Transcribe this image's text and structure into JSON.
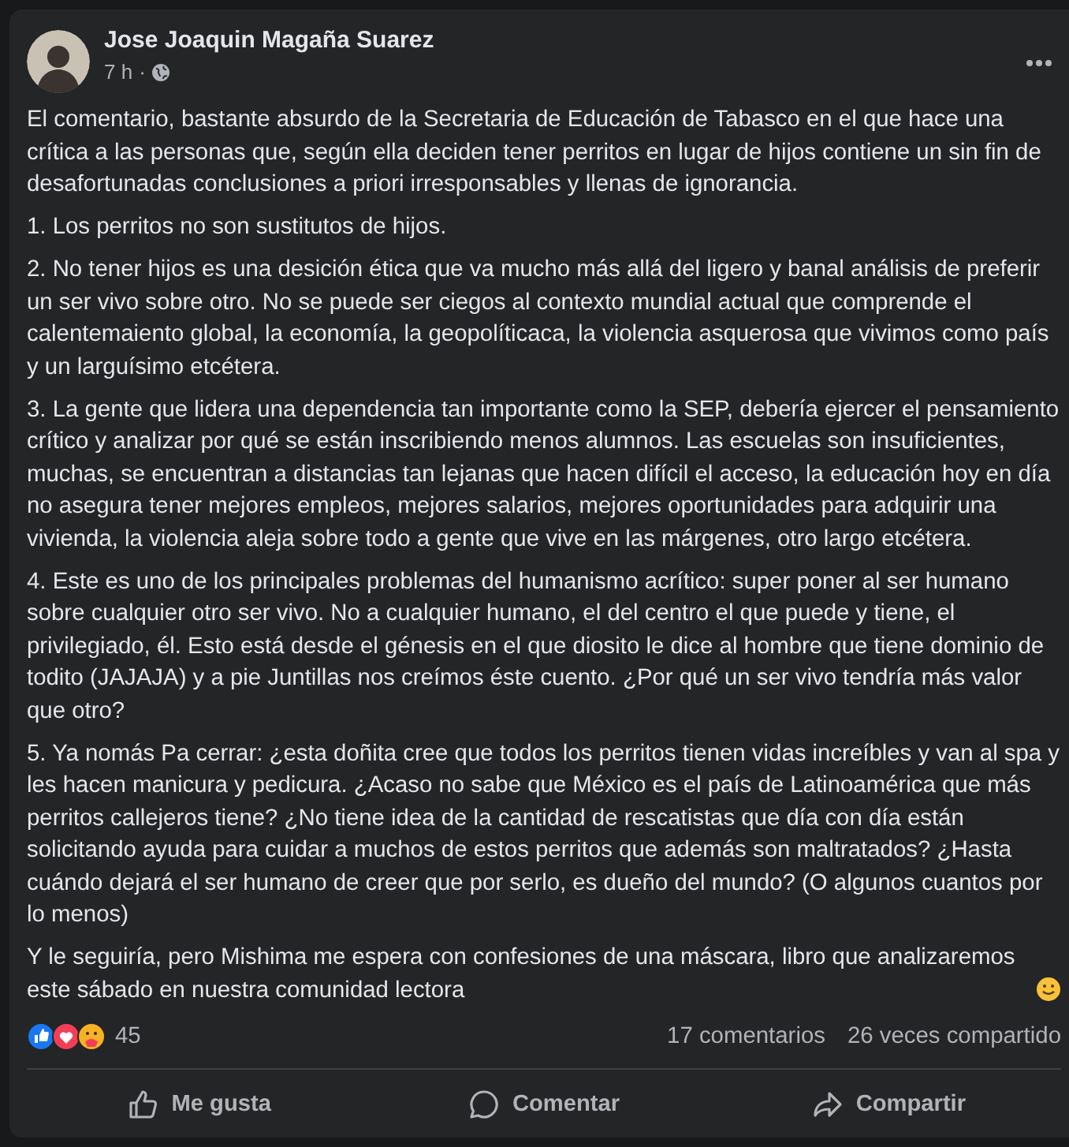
{
  "post": {
    "author": "Jose Joaquin Magaña Suarez",
    "time": "7 h",
    "separator": "·",
    "paragraphs": [
      "El comentario, bastante absurdo de la Secretaria de Educación de Tabasco en el que hace una crítica a las personas que, según ella deciden tener perritos en lugar de hijos contiene un sin fin de desafortunadas conclusiones a priori irresponsables y llenas de ignorancia.",
      "1. Los perritos no son sustitutos de hijos.",
      "2. No tener hijos es una desición ética  que va mucho más allá del ligero y banal análisis de preferir un ser vivo sobre otro. No se puede ser ciegos al contexto mundial actual que comprende el calentemaiento global, la economía, la geopolíticaca, la violencia asquerosa que vivimos como país y un larguísimo etcétera.",
      "3. La gente que lidera una dependencia tan importante como la SEP, debería ejercer el pensamiento crítico y analizar por qué se están inscribiendo menos alumnos. Las escuelas son insuficientes, muchas, se encuentran a distancias tan lejanas que hacen difícil el acceso, la educación hoy en día no asegura tener mejores empleos, mejores salarios, mejores oportunidades para adquirir una vivienda, la violencia aleja sobre todo a gente que vive en las márgenes, otro largo etcétera.",
      "4. Este es uno de los principales problemas del humanismo acrítico: super poner al ser humano sobre cualquier otro ser vivo. No a cualquier humano, el del centro el que puede y tiene, el privilegiado, él. Esto está desde el génesis en el que diosito le dice al hombre que tiene dominio de todito (JAJAJA) y a pie Juntillas nos creímos éste cuento. ¿Por qué un ser vivo tendría más valor que otro?",
      "5. Ya nomás Pa cerrar: ¿esta doñita cree que todos los perritos tienen vidas increíbles y van al spa y les hacen manicura y pedicura. ¿Acaso no sabe que México es el país de Latinoamérica que más perritos callejeros tiene? ¿No tiene idea de la cantidad de rescatistas que día con día están solicitando ayuda para cuidar a muchos de estos perritos que además son maltratados? ¿Hasta cuándo dejará el ser humano de creer que por serlo, es dueño del mundo? (O algunos cuantos por lo menos)",
      "Y le seguiría, pero Mishima me espera con confesiones de una máscara, libro que analizaremos este sábado en nuestra comunidad lectora"
    ],
    "reactions": {
      "count": "45"
    },
    "comments": "17 comentarios",
    "shares": "26 veces compartido",
    "actions": [
      {
        "kind": "like",
        "label": "Me gusta"
      },
      {
        "kind": "comment",
        "label": "Comentar"
      },
      {
        "kind": "share",
        "label": "Compartir"
      }
    ]
  }
}
